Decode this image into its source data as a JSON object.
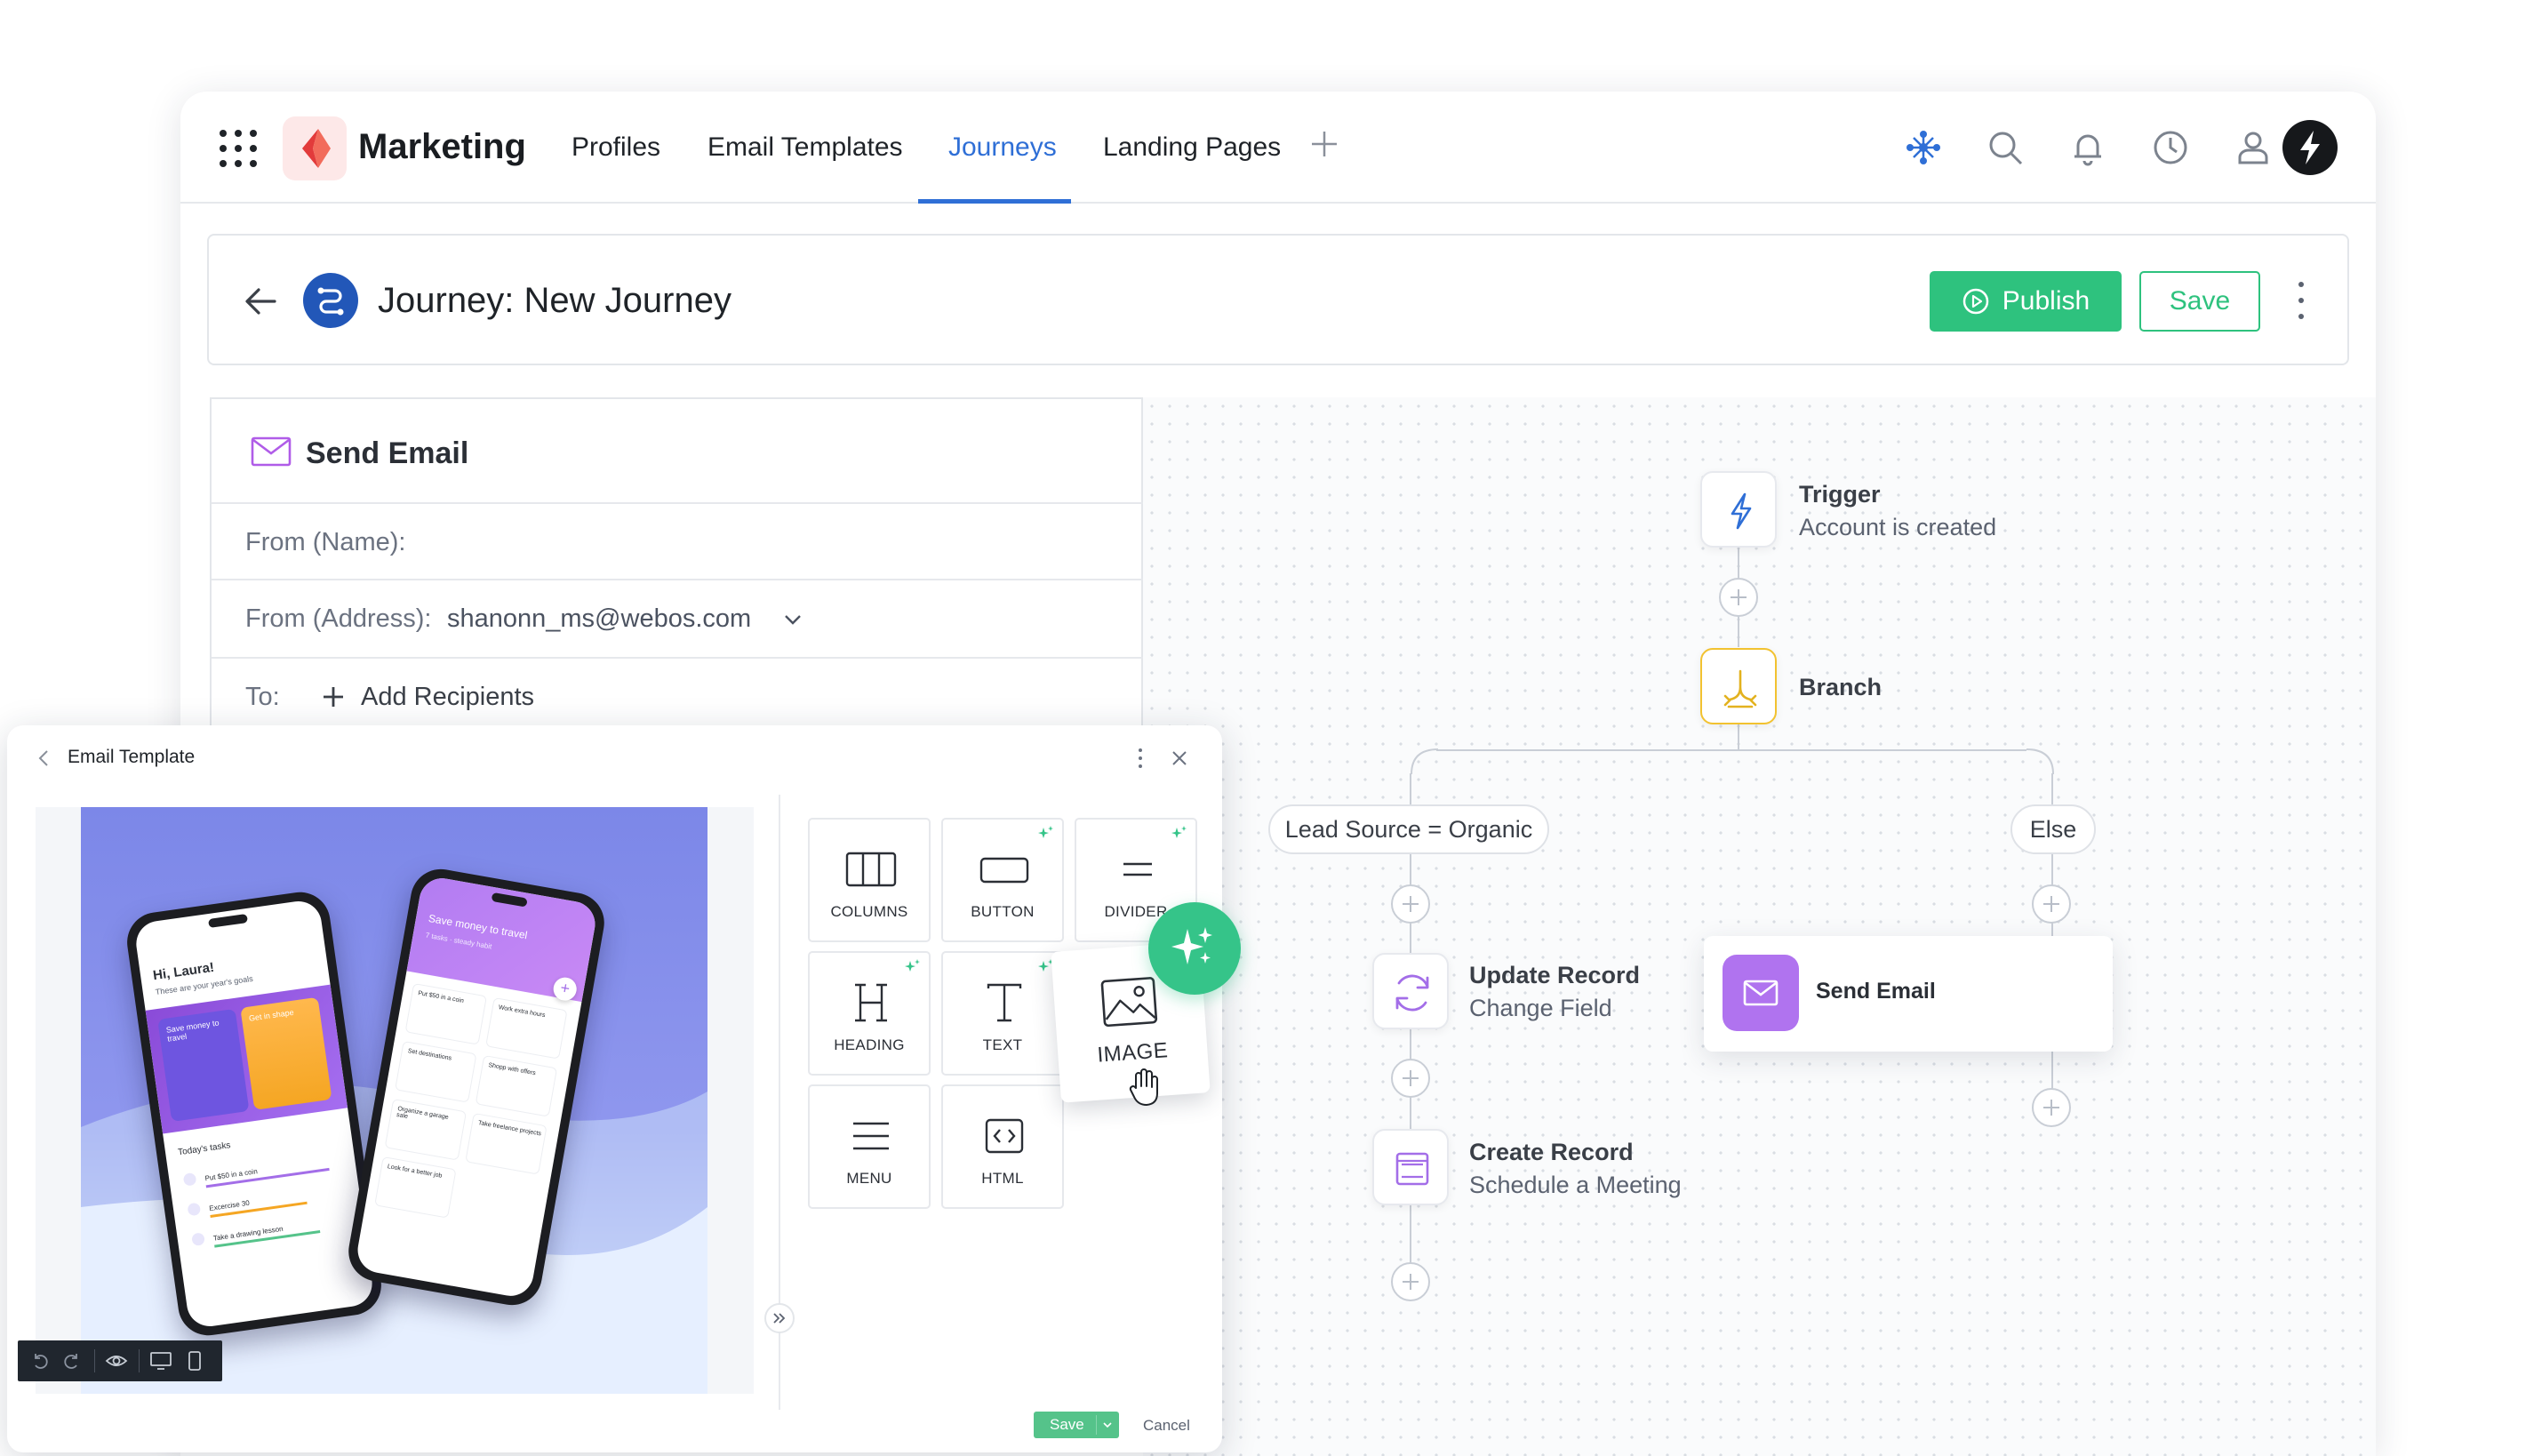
{
  "app": {
    "brand": "Marketing",
    "nav_tabs": [
      {
        "label": "Profiles"
      },
      {
        "label": "Email Templates"
      },
      {
        "label": "Journeys",
        "active": true
      },
      {
        "label": "Landing Pages"
      }
    ],
    "icons": [
      "apps-grid-icon",
      "add-tab-icon",
      "network-icon",
      "search-icon",
      "bell-icon",
      "clock-icon",
      "user-icon",
      "bolt-avatar-icon"
    ],
    "accent_color": "#2f6fd6",
    "brand_color": "#e23b3b"
  },
  "header": {
    "title": "Journey: New Journey",
    "publish_label": "Publish",
    "save_label": "Save"
  },
  "send_email_panel": {
    "title": "Send Email",
    "from_name_label": "From (Name):",
    "from_address_label": "From (Address):",
    "from_address_value": "shanonn_ms@webos.com",
    "to_label": "To:",
    "add_recipients_label": "Add Recipients"
  },
  "journey": {
    "trigger": {
      "title": "Trigger",
      "subtitle": "Account is created"
    },
    "branch": {
      "title": "Branch"
    },
    "branches": [
      {
        "label": "Lead Source = Organic"
      },
      {
        "label": "Else"
      }
    ],
    "update_record": {
      "title": "Update Record",
      "subtitle": "Change Field"
    },
    "create_record": {
      "title": "Create Record",
      "subtitle": "Schedule a Meeting"
    },
    "send_email": {
      "title": "Send Email"
    },
    "colors": {
      "trigger": "#2f6fd6",
      "branch": "#f2c230",
      "purple": "#a36ee8",
      "green": "#2ec27e"
    }
  },
  "email_template": {
    "title": "Email Template",
    "preview": {
      "phone_left": {
        "greeting": "Hi, Laura!",
        "subtitle": "These are your year's goals",
        "cards": [
          "Save money to travel",
          "Get in shape"
        ],
        "tasks_title": "Today's tasks",
        "tasks": [
          "Put $50 in a coin",
          "Excercise 30",
          "Take a drawing lesson"
        ]
      },
      "phone_right": {
        "header": "Save money to travel",
        "meta": "7 tasks  ·  steady habit",
        "items": [
          "Put $50 in a coin",
          "Work extra hours",
          "Set destinations",
          "Shopp with offers",
          "Organize a garage sale",
          "Take freelance projects",
          "Look for a better job"
        ]
      }
    },
    "blocks": [
      {
        "label": "COLUMNS",
        "icon": "columns-icon"
      },
      {
        "label": "BUTTON",
        "icon": "button-icon"
      },
      {
        "label": "DIVIDER",
        "icon": "divider-icon"
      },
      {
        "label": "HEADING",
        "icon": "heading-icon"
      },
      {
        "label": "TEXT",
        "icon": "text-icon"
      },
      {
        "label": "MENU",
        "icon": "menu-icon"
      },
      {
        "label": "HTML",
        "icon": "html-icon"
      }
    ],
    "dragging_block": {
      "label": "IMAGE",
      "icon": "image-icon"
    },
    "save_label": "Save",
    "cancel_label": "Cancel"
  }
}
